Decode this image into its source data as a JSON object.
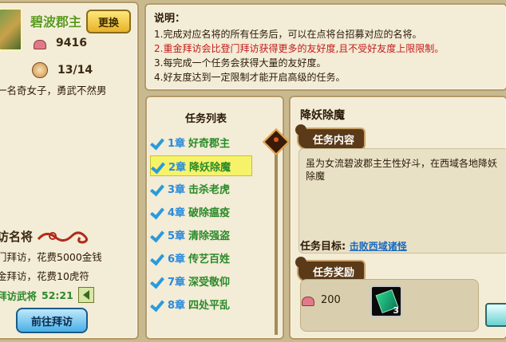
{
  "general": {
    "name": "碧波郡主",
    "change_button": "更换",
    "friendship": "9416",
    "progress": "13/14",
    "intro": "一名奇女子，勇武不然男"
  },
  "visit": {
    "title": "访名将",
    "option1": "门拜访，花费5000金钱",
    "option2": "金拜访，花费10虎符",
    "timer_label": "拜访武将",
    "timer_value": "52:21",
    "go_button": "前往拜访"
  },
  "notes": {
    "title": "说明：",
    "items": [
      "1.完成对应名将的所有任务后，可以在点将台招募对应的名将。",
      "2.重金拜访会比登门拜访获得更多的友好度,且不受好友度上限限制。",
      "3.每完成一个任务会获得大量的友好度。",
      "4.好友度达到一定限制才能开启高级的任务。"
    ]
  },
  "tasks": {
    "title": "任务列表",
    "items": [
      {
        "chapter": "1章",
        "name": "好奇郡主"
      },
      {
        "chapter": "2章",
        "name": "降妖除魔"
      },
      {
        "chapter": "3章",
        "name": "击杀老虎"
      },
      {
        "chapter": "4章",
        "name": "破除瘟疫"
      },
      {
        "chapter": "5章",
        "name": "清除强盗"
      },
      {
        "chapter": "6章",
        "name": "传艺百姓"
      },
      {
        "chapter": "7章",
        "name": "深受敬仰"
      },
      {
        "chapter": "8章",
        "name": "四处平乱"
      }
    ],
    "selected_index": 1
  },
  "detail": {
    "title": "降妖除魔",
    "content_tag": "任务内容",
    "content_text": "虽为女流碧波郡主生性好斗，在西域各地降妖除魔",
    "goal_label": "任务目标:",
    "goal_link": "击败西域诸怪",
    "reward_tag": "任务奖励",
    "reward_amount": "200",
    "reward_item_count": "3"
  },
  "colors": {
    "accent_green": "#2a8a2a",
    "link_blue": "#1a6abf",
    "warning_red": "#c41a1a",
    "panel_bg": "#f3ecd6"
  }
}
